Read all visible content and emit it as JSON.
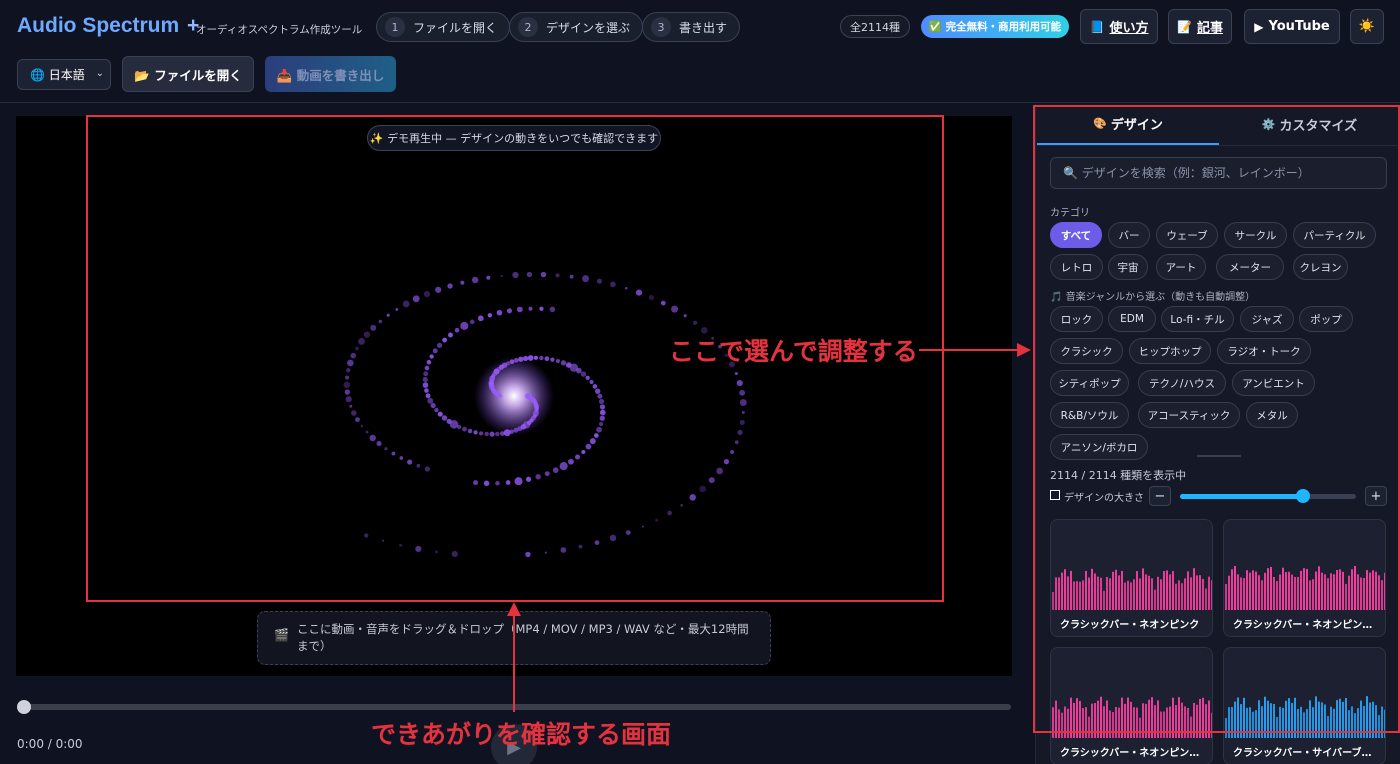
{
  "header": {
    "brand": "Audio Spectrum",
    "brand_plus": "+",
    "tagline": "オーディオスペクトラム作成ツール",
    "steps": [
      {
        "num": "1",
        "label": "ファイルを開く"
      },
      {
        "num": "2",
        "label": "デザインを選ぶ"
      },
      {
        "num": "3",
        "label": "書き出す"
      }
    ],
    "count_pill": "全2114種",
    "free_pill": "✅ 完全無料・商用利用可能",
    "howto": {
      "icon": "📘",
      "label": "使い方"
    },
    "article": {
      "icon": "📝",
      "label": "記事"
    },
    "youtube": {
      "icon": "▶",
      "label": "YouTube"
    },
    "theme_icon": "☀️"
  },
  "toolbar": {
    "language": "🌐 日本語",
    "open_file": "📂 ファイルを開く",
    "export_video": "📥 動画を書き出し"
  },
  "preview": {
    "demo_notice": "✨ デモ再生中 — デザインの動きをいつでも確認できます",
    "drop_icon": "🎬",
    "drop_text": "ここに動画・音声をドラッグ＆ドロップ（MP4 / MOV / MP3 / WAV など・最大12時間まで）",
    "time": "0:00 / 0:00",
    "seek_position": 0
  },
  "annotations": {
    "preview_caption": "できあがりを確認する画面",
    "panel_caption": "ここで選んで調整する"
  },
  "panel": {
    "tabs": [
      {
        "icon": "🎨",
        "label": "デザイン"
      },
      {
        "icon": "⚙️",
        "label": "カスタマイズ"
      }
    ],
    "search_placeholder": "🔍 デザインを検索（例：銀河、レインボー）",
    "category_label": "カテゴリ",
    "categories": [
      "すべて",
      "バー",
      "ウェーブ",
      "サークル",
      "パーティクル",
      "レトロ",
      "宇宙",
      "アート",
      "メーター",
      "クレヨン"
    ],
    "genre_label": "🎵 音楽ジャンルから選ぶ（動きも自動調整）",
    "genres": [
      "ロック",
      "EDM",
      "Lo-fi・チル",
      "ジャズ",
      "ポップ",
      "クラシック",
      "ヒップホップ",
      "ラジオ・トーク",
      "シティポップ",
      "テクノ/ハウス",
      "アンビエント",
      "R&B/ソウル",
      "アコースティック",
      "メタル",
      "アニソン/ボカロ"
    ],
    "showing": "2114 / 2114 種類を表示中",
    "size_label": "デザインの大きさ",
    "size_value": 0.7,
    "minus": "−",
    "plus": "+",
    "cards": [
      {
        "name": "クラシックバー・ネオンピンク",
        "color": "#ff3fa4"
      },
      {
        "name": "クラシックバー・ネオンピン…",
        "color": "#ff3fa4"
      },
      {
        "name": "クラシックバー・ネオンピン…",
        "color": "#ff3fa4"
      },
      {
        "name": "クラシックバー・サイバーブルー",
        "color": "#25a8ff"
      }
    ]
  }
}
